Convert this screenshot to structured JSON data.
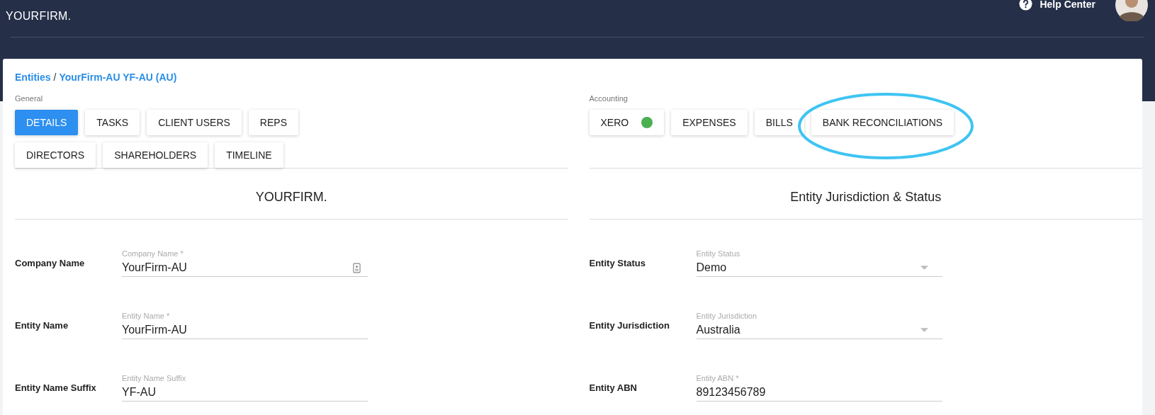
{
  "header": {
    "logo": "YOURFIRM.",
    "help": "Help Center"
  },
  "breadcrumb": [
    {
      "label": "Entities"
    },
    {
      "label": "YourFirm-AU YF-AU (AU)"
    }
  ],
  "breadcrumb_separator": "/",
  "columns": [
    {
      "group_label": "General",
      "tab_rows": [
        [
          {
            "label": "DETAILS",
            "selected": true,
            "circled": false
          },
          {
            "label": "TASKS",
            "selected": false,
            "circled": false
          },
          {
            "label": "CLIENT USERS",
            "selected": false,
            "circled": false
          },
          {
            "label": "REPS",
            "selected": false,
            "circled": false
          }
        ],
        [
          {
            "label": "DIRECTORS",
            "selected": false,
            "circled": false
          },
          {
            "label": "SHAREHOLDERS",
            "selected": false,
            "circled": false
          },
          {
            "label": "TIMELINE",
            "selected": false,
            "circled": false
          }
        ]
      ],
      "section_title": "YOURFIRM.",
      "fields": [
        {
          "label": "Company Name",
          "kind": "text",
          "floating_label": "Company Name *",
          "value": "YourFirm-AU",
          "has_icon": true
        },
        {
          "label": "Entity Name",
          "kind": "text",
          "floating_label": "Entity Name *",
          "value": "YourFirm-AU",
          "has_icon": false
        },
        {
          "label": "Entity Name Suffix",
          "kind": "text",
          "floating_label": "Entity Name Suffix",
          "value": "YF-AU",
          "has_icon": false
        }
      ]
    },
    {
      "group_label": "Accounting",
      "tab_rows": [
        [
          {
            "label": "XERO",
            "selected": false,
            "circled": false,
            "color": "#4caf50"
          },
          {
            "label": "EXPENSES",
            "selected": false,
            "circled": false
          },
          {
            "label": "BILLS",
            "selected": false,
            "circled": false
          },
          {
            "label": "BANK RECONCILIATIONS",
            "selected": false,
            "circled": true
          }
        ]
      ],
      "section_title": "Entity Jurisdiction & Status",
      "fields": [
        {
          "label": "Entity Status",
          "kind": "select",
          "floating_label": "Entity Status",
          "value": "Demo",
          "has_icon": false
        },
        {
          "label": "Entity Jurisdiction",
          "kind": "select",
          "floating_label": "Entity Jurisdiction",
          "value": "Australia",
          "has_icon": false
        },
        {
          "label": "Entity ABN",
          "kind": "text",
          "floating_label": "Entity ABN *",
          "value": "89123456789",
          "has_icon": false
        }
      ]
    }
  ]
}
